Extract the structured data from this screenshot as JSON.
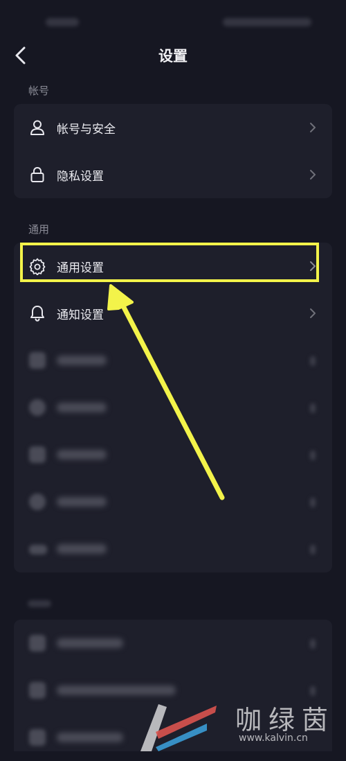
{
  "header": {
    "title": "设置"
  },
  "sections": {
    "account_label": "帐号",
    "general_label": "通用"
  },
  "rows": {
    "account_security": "帐号与安全",
    "privacy": "隐私设置",
    "general": "通用设置",
    "notifications": "通知设置"
  },
  "annotation": {
    "highlight_color": "#f3f34a"
  },
  "watermark": {
    "brand": "咖绿茵",
    "url": "www.kalvin.cn"
  }
}
